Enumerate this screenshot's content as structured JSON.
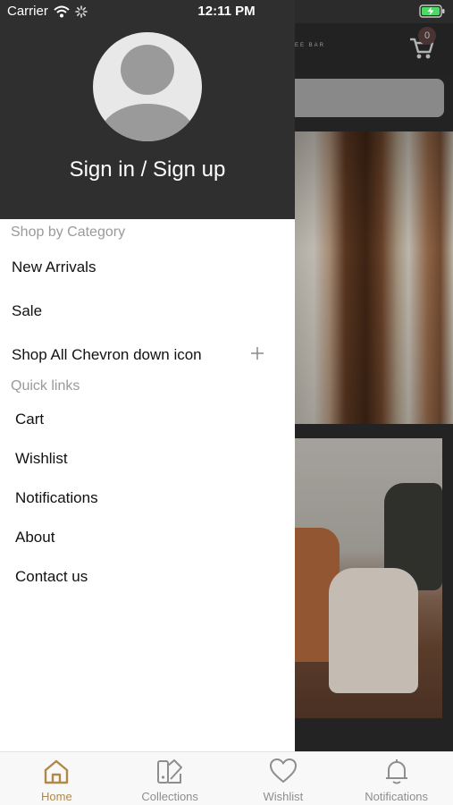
{
  "status_bar": {
    "carrier": "Carrier",
    "time": "12:11 PM"
  },
  "background": {
    "marquee_text": "EE BAR",
    "cart_count": "0"
  },
  "drawer": {
    "signin_label": "Sign in / Sign up",
    "category_title": "Shop by Category",
    "categories": [
      "New Arrivals",
      "Sale",
      "Shop All Chevron down icon"
    ],
    "quick_links_title": "Quick links",
    "quick_links": [
      "Cart",
      "Wishlist",
      "Notifications",
      "About",
      "Contact us"
    ]
  },
  "tab_bar": {
    "tabs": [
      {
        "label": "Home",
        "icon": "home-icon",
        "active": true
      },
      {
        "label": "Collections",
        "icon": "collections-icon",
        "active": false
      },
      {
        "label": "Wishlist",
        "icon": "heart-icon",
        "active": false
      },
      {
        "label": "Notifications",
        "icon": "bell-icon",
        "active": false
      }
    ]
  },
  "colors": {
    "accent": "#b0884a",
    "drawer_header": "#2f2f2f",
    "tab_inactive": "#8e8e8e"
  }
}
